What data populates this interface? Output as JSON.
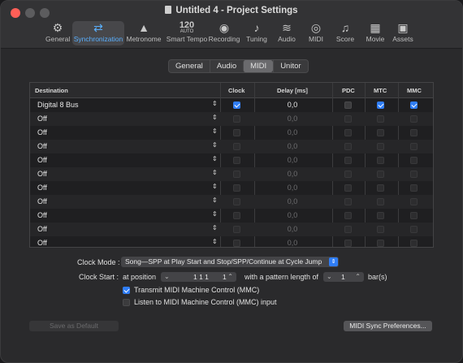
{
  "window": {
    "title": "Untitled 4 - Project Settings"
  },
  "toolbar": [
    {
      "label": "General",
      "icon": "gear-icon",
      "glyph": "⚙"
    },
    {
      "label": "Synchronization",
      "icon": "sync-icon",
      "glyph": "⇄"
    },
    {
      "label": "Metronome",
      "icon": "metronome-icon",
      "glyph": "▲"
    },
    {
      "label": "Smart Tempo",
      "icon": "smart-tempo-icon",
      "num": "120",
      "sub": "AUTO"
    },
    {
      "label": "Recording",
      "icon": "record-icon",
      "glyph": "◉"
    },
    {
      "label": "Tuning",
      "icon": "tuning-icon",
      "glyph": "♪"
    },
    {
      "label": "Audio",
      "icon": "waveform-icon",
      "glyph": "≋"
    },
    {
      "label": "MIDI",
      "icon": "midi-icon",
      "glyph": "◎"
    },
    {
      "label": "Score",
      "icon": "score-icon",
      "glyph": "♫"
    },
    {
      "label": "Movie",
      "icon": "film-icon",
      "glyph": "▦"
    },
    {
      "label": "Assets",
      "icon": "briefcase-icon",
      "glyph": "▣"
    }
  ],
  "tabs": [
    "General",
    "Audio",
    "MIDI",
    "Unitor"
  ],
  "table": {
    "headers": {
      "destination": "Destination",
      "clock": "Clock",
      "delay": "Delay [ms]",
      "pdc": "PDC",
      "mtc": "MTC",
      "mmc": "MMC"
    },
    "rows": [
      {
        "dest": "Digital 8 Bus",
        "clock": true,
        "delay": "0,0",
        "pdc": false,
        "mtc": true,
        "mmc": true,
        "enabled": true
      },
      {
        "dest": "Off",
        "clock": false,
        "delay": "0,0",
        "pdc": false,
        "mtc": false,
        "mmc": false,
        "enabled": false
      },
      {
        "dest": "Off",
        "clock": false,
        "delay": "0,0",
        "pdc": false,
        "mtc": false,
        "mmc": false,
        "enabled": false
      },
      {
        "dest": "Off",
        "clock": false,
        "delay": "0,0",
        "pdc": false,
        "mtc": false,
        "mmc": false,
        "enabled": false
      },
      {
        "dest": "Off",
        "clock": false,
        "delay": "0,0",
        "pdc": false,
        "mtc": false,
        "mmc": false,
        "enabled": false
      },
      {
        "dest": "Off",
        "clock": false,
        "delay": "0,0",
        "pdc": false,
        "mtc": false,
        "mmc": false,
        "enabled": false
      },
      {
        "dest": "Off",
        "clock": false,
        "delay": "0,0",
        "pdc": false,
        "mtc": false,
        "mmc": false,
        "enabled": false
      },
      {
        "dest": "Off",
        "clock": false,
        "delay": "0,0",
        "pdc": false,
        "mtc": false,
        "mmc": false,
        "enabled": false
      },
      {
        "dest": "Off",
        "clock": false,
        "delay": "0,0",
        "pdc": false,
        "mtc": false,
        "mmc": false,
        "enabled": false
      },
      {
        "dest": "Off",
        "clock": false,
        "delay": "0,0",
        "pdc": false,
        "mtc": false,
        "mmc": false,
        "enabled": false
      },
      {
        "dest": "Off",
        "clock": false,
        "delay": "0,0",
        "pdc": false,
        "mtc": false,
        "mmc": false,
        "enabled": false
      }
    ]
  },
  "form": {
    "clock_mode_label": "Clock Mode :",
    "clock_mode_value": "Song—SPP at Play Start and Stop/SPP/Continue at Cycle Jump",
    "clock_start_label": "Clock Start :",
    "at_position": "at position",
    "position_value": "1 1 1",
    "position_tick": "1",
    "pattern_text": "with a pattern length of",
    "pattern_value": "1",
    "bars": "bar(s)",
    "transmit_mmc": "Transmit MIDI Machine Control (MMC)",
    "transmit_checked": true,
    "listen_mmc": "Listen to MIDI Machine Control (MMC) input",
    "listen_checked": false
  },
  "buttons": {
    "save_default": "Save as Default",
    "midi_sync_prefs": "MIDI Sync Preferences..."
  },
  "colors": {
    "accent": "#2f7df6",
    "active_tab_text": "#5ab0ff",
    "close": "#ff5f57"
  }
}
